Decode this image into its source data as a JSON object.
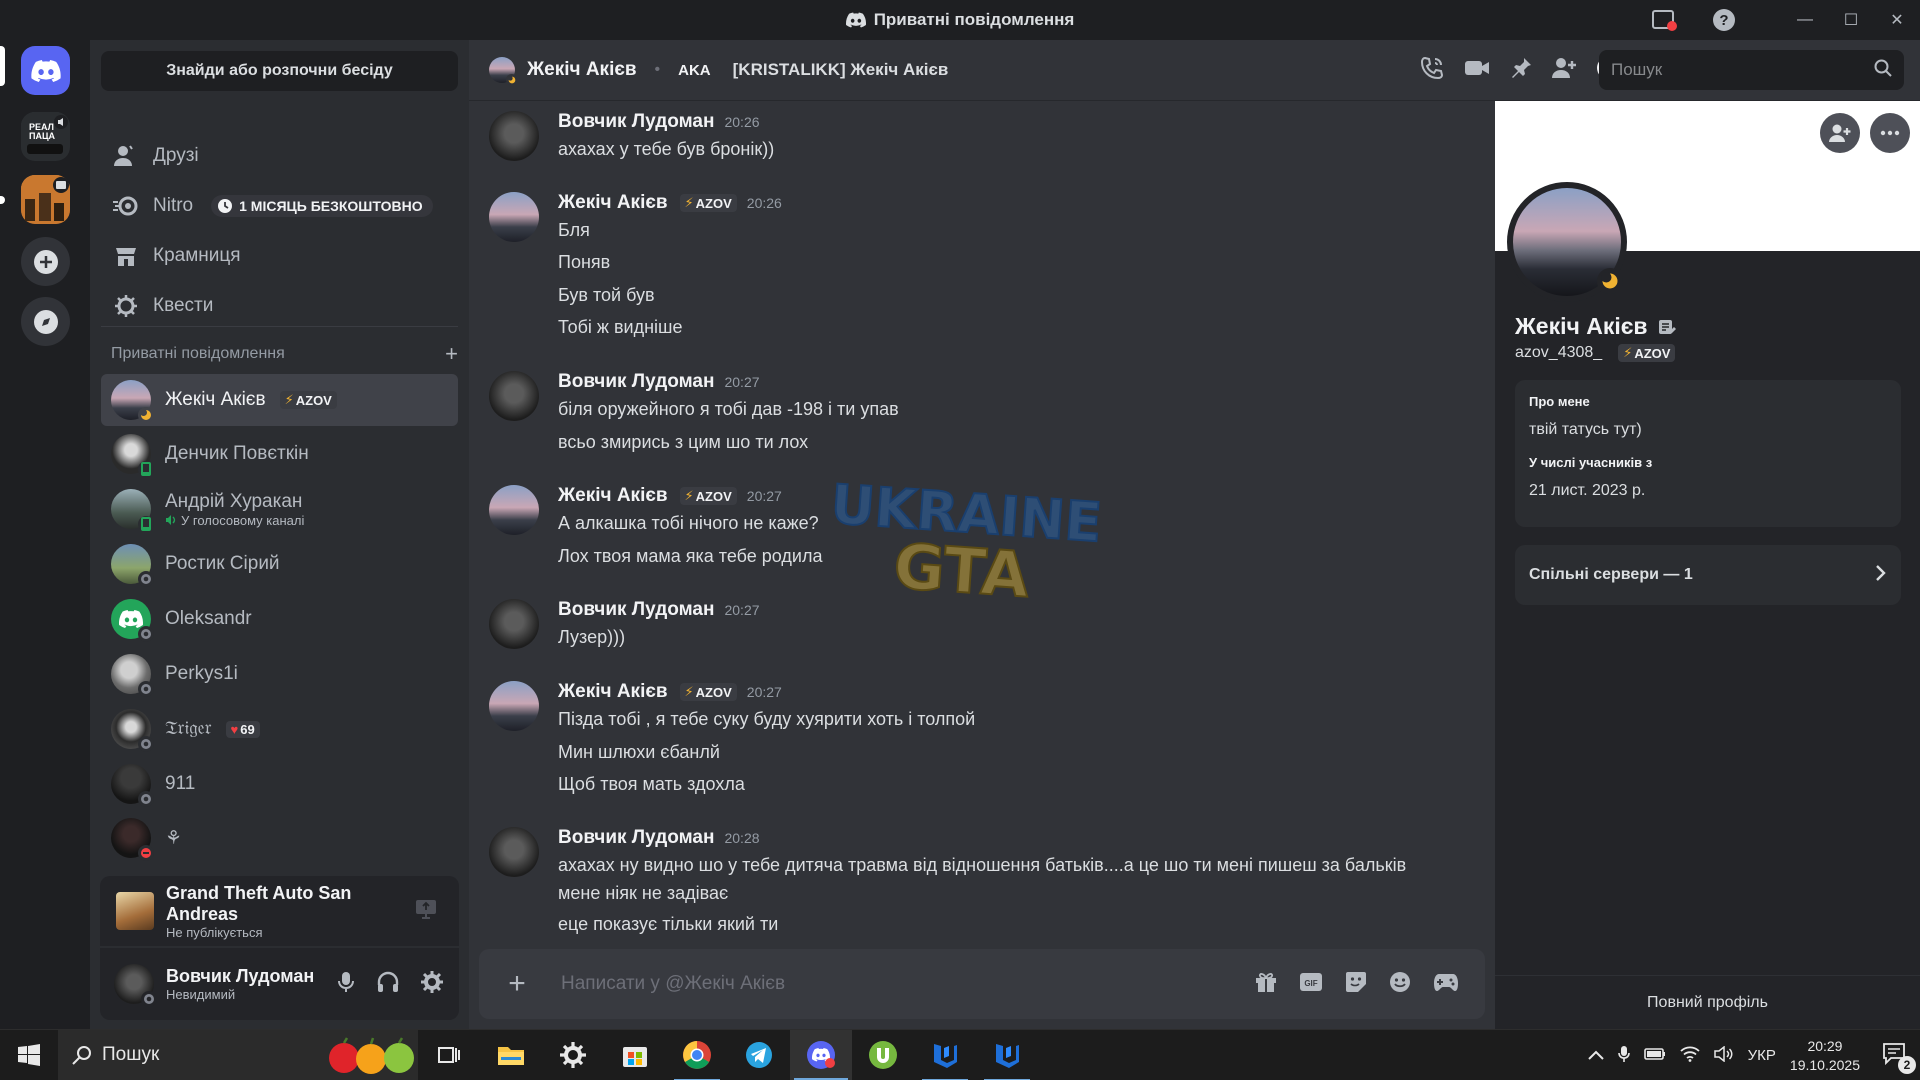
{
  "window": {
    "title": "Приватні повідомлення"
  },
  "sidebar": {
    "search_button": "Знайди або розпочни бесіду",
    "nav": [
      {
        "label": "Друзі",
        "icon": "friends-icon"
      },
      {
        "label": "Nitro",
        "icon": "nitro-icon",
        "badge": "1 МІСЯЦЬ БЕЗКОШТОВНО"
      },
      {
        "label": "Крамниця",
        "icon": "shop-icon"
      },
      {
        "label": "Квести",
        "icon": "quests-icon"
      }
    ],
    "dm_header": "Приватні повідомлення",
    "dms": [
      {
        "name": "Жекіч Акієв",
        "tag": "AZOV",
        "status": "idle",
        "active": true
      },
      {
        "name": "Денчик Повєткін",
        "status": "mobile"
      },
      {
        "name": "Андрій Хуракан",
        "sub": "У голосовому каналі",
        "status": "mobile"
      },
      {
        "name": "Ростик Сірий",
        "status": "offline"
      },
      {
        "name": "Oleksandr",
        "status": "offline"
      },
      {
        "name": "Perkys1i",
        "status": "offline"
      },
      {
        "name": "𝔗𝔯𝔦𝔤𝔢𝔯",
        "tag": "69",
        "status": "offline"
      },
      {
        "name": "911",
        "status": "offline"
      },
      {
        "name": "⚘",
        "status": "dnd"
      }
    ]
  },
  "activity": {
    "game": "Grand Theft Auto San Andreas",
    "status": "Не публікується"
  },
  "user": {
    "name": "Вовчик Лудоман",
    "status": "Невидимий"
  },
  "chat": {
    "header_name": "Жекіч Акієв",
    "aka_label": "AKA",
    "aka_value": "[KRISTALIKK] Жекіч Акієв",
    "search_placeholder": "Пошук",
    "composer_placeholder": "Написати у @Жекіч Акієв",
    "messages": [
      {
        "author": "Вовчик Лудоман",
        "time": "20:26",
        "lines": [
          "ахахах у тебе був бронік))"
        ]
      },
      {
        "author": "Жекіч Акієв",
        "tag": "AZOV",
        "time": "20:26",
        "lines": [
          "Бля",
          "Поняв",
          "Був той був",
          "Тобі ж видніше"
        ]
      },
      {
        "author": "Вовчик Лудоман",
        "time": "20:27",
        "lines": [
          "біля оружейного я тобі дав -198 і ти упав",
          "всьо змирись з цим шо ти лох"
        ]
      },
      {
        "author": "Жекіч Акієв",
        "tag": "AZOV",
        "time": "20:27",
        "lines": [
          "А алкашка тобі нічого не каже?",
          "Лох твоя мама яка тебе родила"
        ]
      },
      {
        "author": "Вовчик Лудоман",
        "time": "20:27",
        "lines": [
          "Лузер)))"
        ]
      },
      {
        "author": "Жекіч Акієв",
        "tag": "AZOV",
        "time": "20:27",
        "lines": [
          "Пізда тобі , я тебе суку буду хуярити хоть і толпой",
          "Мин шлюхи єбанлй",
          "Щоб твоя мать здохла"
        ]
      },
      {
        "author": "Вовчик Лудоман",
        "time": "20:28",
        "lines": [
          "ахахах ну видно шо у тебе дитяча травма від відношення батьків....а це шо ти мені пишеш за бальків",
          "мене ніяк не задіває",
          "еце показує тільки який ти"
        ]
      }
    ]
  },
  "profile": {
    "name": "Жекіч Акієв",
    "username": "azov_4308_",
    "tag": "AZOV",
    "about_label": "Про мене",
    "about_value": "твій татусь тут)",
    "member_label": "У числі учасників з",
    "member_value": "21 лист. 2023 р.",
    "servers": "Спільні сервери — 1",
    "full_profile": "Повний профіль"
  },
  "taskbar": {
    "search": "Пошук",
    "lang": "УКР",
    "time": "20:29",
    "date": "19.10.2025",
    "notifications": "2"
  },
  "watermark": {
    "line1": "UKRAINE",
    "line2": "GTA"
  },
  "colors": {
    "accent": "#5865f2",
    "idle": "#f0b232",
    "online": "#23a55a",
    "dnd": "#f23f43",
    "offline": "#80848e"
  }
}
